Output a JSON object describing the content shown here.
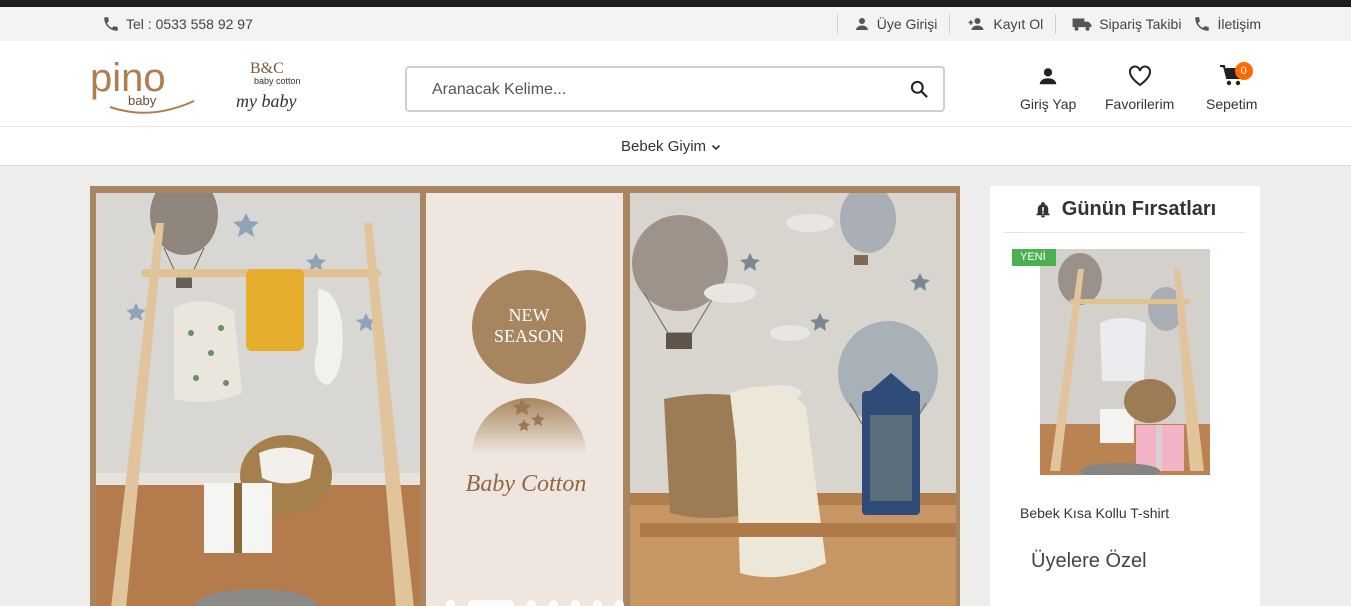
{
  "topbar": {
    "phone": "Tel : 0533 558 92 97",
    "links": [
      {
        "label": "Üye Girişi",
        "icon": "user-icon"
      },
      {
        "label": "Kayıt Ol",
        "icon": "user-plus-icon"
      },
      {
        "label": "Sipariş Takibi",
        "icon": "truck-icon"
      },
      {
        "label": "İletişim",
        "icon": "phone-icon"
      }
    ]
  },
  "logos": {
    "pino_main": "pino",
    "pino_sub": "baby",
    "bc_main": "B&C",
    "bc_sub": "baby cotton",
    "bc_tag": "my baby"
  },
  "search": {
    "placeholder": "Aranacak Kelime..."
  },
  "header_actions": {
    "login": "Giriş Yap",
    "favorites": "Favorilerim",
    "cart": "Sepetim",
    "cart_count": "0"
  },
  "nav": {
    "items": [
      {
        "label": "Bebek Giyim"
      }
    ]
  },
  "slider": {
    "badge_line1": "NEW",
    "badge_line2": "SEASON",
    "brand_script": "Baby Cotton",
    "dots": 7,
    "active_dot": 1
  },
  "sidebar": {
    "title": "Günün Fırsatları",
    "new_badge": "YENİ",
    "product_name": "Bebek Kısa Kollu T-shirt",
    "members_only": "Üyelere Özel"
  },
  "colors": {
    "accent": "#ff6a00",
    "frame": "#a9865f",
    "new_badge": "#4caf50"
  }
}
